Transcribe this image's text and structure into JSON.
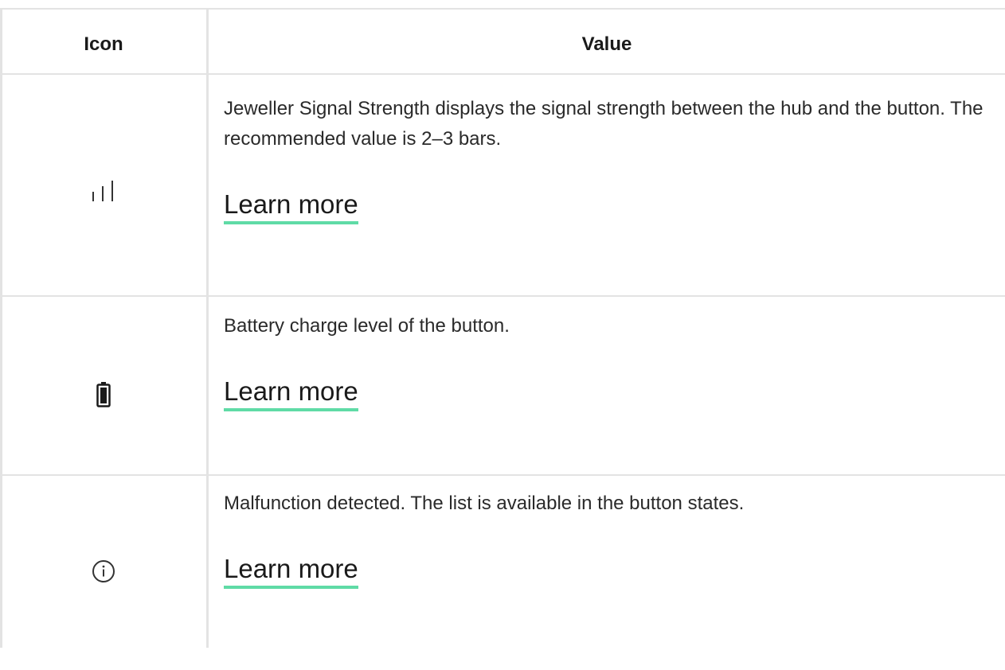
{
  "table": {
    "headers": {
      "icon": "Icon",
      "value": "Value"
    },
    "rows": [
      {
        "icon": "signal-strength-icon",
        "description": "Jeweller Signal Strength displays the signal strength between the hub and the button. The recommended value is 2–3 bars.",
        "link": "Learn more"
      },
      {
        "icon": "battery-icon",
        "description": "Battery charge level of the button.",
        "link": "Learn more"
      },
      {
        "icon": "info-icon",
        "description": "Malfunction detected. The list is available in the button states.",
        "link": "Learn more"
      }
    ]
  },
  "colors": {
    "border": "#e3e3e3",
    "link_underline": "#5fdba6",
    "text": "#2a2a2a"
  }
}
